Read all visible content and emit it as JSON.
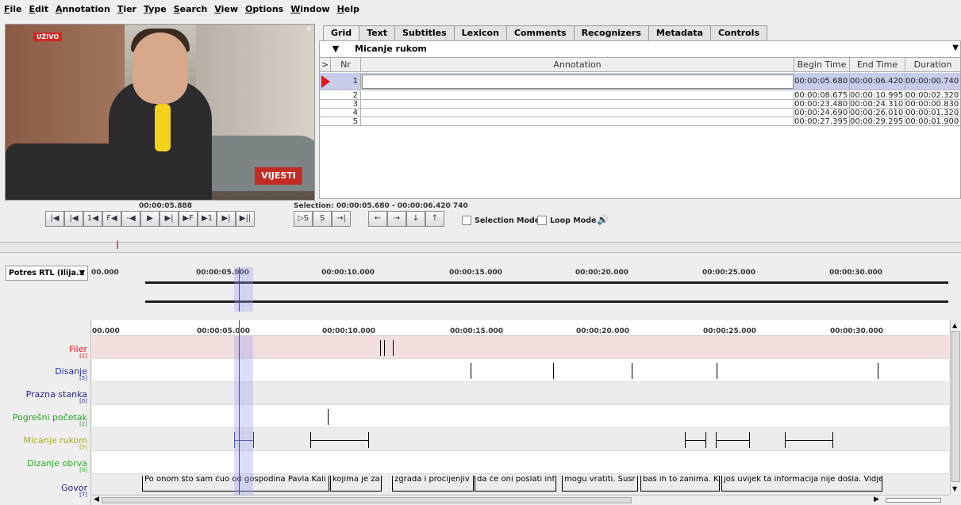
{
  "menu": [
    "File",
    "Edit",
    "Annotation",
    "Tier",
    "Type",
    "Search",
    "View",
    "Options",
    "Window",
    "Help"
  ],
  "video": {
    "live_badge": "UŽIVO",
    "logo_top": "RTL",
    "logo_text": "VIJESTI"
  },
  "tabs": [
    "Grid",
    "Text",
    "Subtitles",
    "Lexicon",
    "Comments",
    "Recognizers",
    "Metadata",
    "Controls"
  ],
  "grid": {
    "tier_name": "Micanje rukom",
    "headers": [
      ">",
      "Nr",
      "Annotation",
      "Begin Time",
      "End Time",
      "Duration"
    ],
    "rows": [
      {
        "nr": "1",
        "annotation": "",
        "begin": "00:00:05.680",
        "end": "00:00:06.420",
        "duration": "00:00:00.740"
      },
      {
        "nr": "2",
        "annotation": "",
        "begin": "00:00:08.675",
        "end": "00:00:10.995",
        "duration": "00:00:02.320"
      },
      {
        "nr": "3",
        "annotation": "",
        "begin": "00:00:23.480",
        "end": "00:00:24.310",
        "duration": "00:00:00.830"
      },
      {
        "nr": "4",
        "annotation": "",
        "begin": "00:00:24.690",
        "end": "00:00:26.010",
        "duration": "00:00:01.320"
      },
      {
        "nr": "5",
        "annotation": "",
        "begin": "00:00:27.395",
        "end": "00:00:29.295",
        "duration": "00:00:01.900"
      }
    ]
  },
  "player": {
    "current_time": "00:00:05.888",
    "selection": "Selection: 00:00:05.680 - 00:00:06.420  740",
    "buttons": [
      "|◀",
      "|◀",
      "1◀",
      "F◀",
      "-◀",
      "▶",
      "▶|",
      "▶F",
      "▶1",
      "▶|",
      "▶||"
    ],
    "sel_buttons": [
      "▷S",
      "S",
      "→|"
    ],
    "nav_buttons": [
      "←",
      "→",
      "↓",
      "↑"
    ],
    "selection_mode": "Selection Mode",
    "loop_mode": "Loop Mode"
  },
  "waveform": {
    "tier_dropdown": "Potres RTL (Ilija...",
    "ticks": [
      "00.000",
      "00:00:05.000",
      "00:00:10.000",
      "00:00:15.000",
      "00:00:20.000",
      "00:00:25.000",
      "00:00:30.000"
    ]
  },
  "tiers": [
    {
      "name": "Filer",
      "count": "[2]",
      "color": "#e0171d"
    },
    {
      "name": "Disanje",
      "count": "[5]",
      "color": "#2233aa"
    },
    {
      "name": "Prazna stanka",
      "count": "[0]",
      "color": "#222288"
    },
    {
      "name": "Pogrešni početak",
      "count": "[1]",
      "color": "#2aa02a"
    },
    {
      "name": "Micanje rukom",
      "count": "[5]",
      "color": "#aaaa22"
    },
    {
      "name": "Dizanje obrva",
      "count": "[0]",
      "color": "#22aa22"
    },
    {
      "name": "Govor",
      "count": "[7]",
      "color": "#222288"
    }
  ],
  "govor_annotations": [
    "Po onom što sam čuo od gospodina Pavla Kali",
    "kojima je za",
    "zgrada i procijenjiv",
    "da će oni poslati inf",
    "mogu vratiti. Susr",
    "baš ih to zanima. K",
    "još uvijek ta informacija nije došla. Vidjel"
  ]
}
